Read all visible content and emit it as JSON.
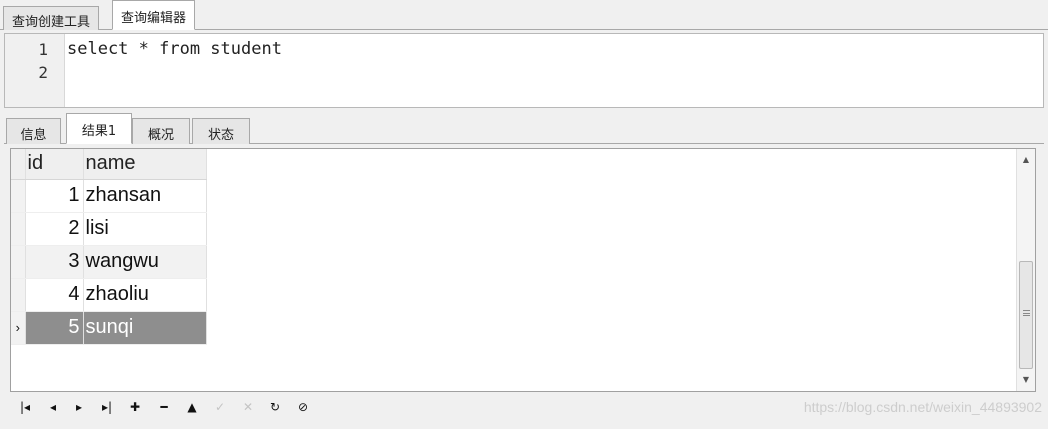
{
  "top_tabs": [
    "查询创建工具",
    "查询编辑器"
  ],
  "editor": {
    "line_numbers": [
      "1",
      "2"
    ],
    "lines": [
      "select * from student",
      ""
    ]
  },
  "result_tabs": [
    "信息",
    "结果1",
    "概况",
    "状态"
  ],
  "grid": {
    "columns": [
      "id",
      "name"
    ],
    "rows": [
      {
        "id": "1",
        "name": "zhansan"
      },
      {
        "id": "2",
        "name": "lisi"
      },
      {
        "id": "3",
        "name": "wangwu"
      },
      {
        "id": "4",
        "name": "zhaoliu"
      },
      {
        "id": "5",
        "name": "sunqi"
      }
    ],
    "selected_row_indicator": "›"
  },
  "toolbar": {
    "buttons": [
      {
        "icon": "first-record-icon",
        "glyph": "|◂"
      },
      {
        "icon": "prev-record-icon",
        "glyph": "◂"
      },
      {
        "icon": "next-record-icon",
        "glyph": "▸"
      },
      {
        "icon": "last-record-icon",
        "glyph": "▸|"
      },
      {
        "icon": "add-record-icon",
        "glyph": "✚"
      },
      {
        "icon": "delete-record-icon",
        "glyph": "━"
      },
      {
        "icon": "edit-up-icon",
        "glyph": "▲"
      },
      {
        "icon": "apply-icon",
        "glyph": "✓"
      },
      {
        "icon": "cancel-icon",
        "glyph": "✕"
      },
      {
        "icon": "refresh-icon",
        "glyph": "↻"
      },
      {
        "icon": "stop-icon",
        "glyph": "⊘"
      }
    ]
  },
  "watermark": "https://blog.csdn.net/weixin_44893902"
}
